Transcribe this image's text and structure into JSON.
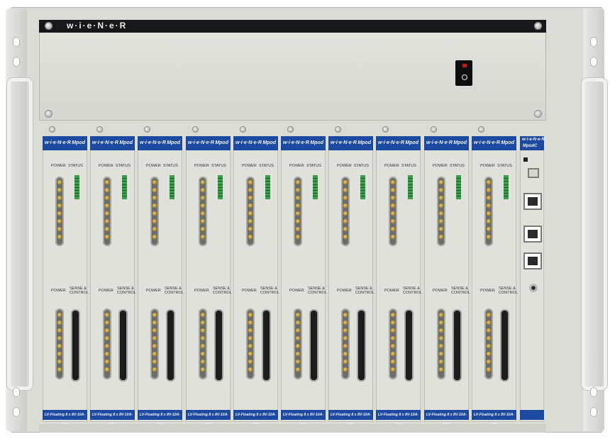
{
  "brand": "w·i·e·N·e·R",
  "modules": [
    {
      "brand": "w·i·e·N·e·R",
      "model": "Mpod",
      "label_power": "POWER",
      "label_status": "STATUS",
      "label_sense": "SENSE & CONTROL",
      "footer": "LV-Floating 8 x 8V-10A-50W"
    },
    {
      "brand": "w·i·e·N·e·R",
      "model": "Mpod",
      "label_power": "POWER",
      "label_status": "STATUS",
      "label_sense": "SENSE & CONTROL",
      "footer": "LV-Floating 8 x 8V-10A-50W"
    },
    {
      "brand": "w·i·e·N·e·R",
      "model": "Mpod",
      "label_power": "POWER",
      "label_status": "STATUS",
      "label_sense": "SENSE & CONTROL",
      "footer": "LV-Floating 8 x 8V-10A-50W"
    },
    {
      "brand": "w·i·e·N·e·R",
      "model": "Mpod",
      "label_power": "POWER",
      "label_status": "STATUS",
      "label_sense": "SENSE & CONTROL",
      "footer": "LV-Floating 8 x 8V-10A-50W"
    },
    {
      "brand": "w·i·e·N·e·R",
      "model": "Mpod",
      "label_power": "POWER",
      "label_status": "STATUS",
      "label_sense": "SENSE & CONTROL",
      "footer": "LV-Floating 8 x 8V-10A-50W"
    },
    {
      "brand": "w·i·e·N·e·R",
      "model": "Mpod",
      "label_power": "POWER",
      "label_status": "STATUS",
      "label_sense": "SENSE & CONTROL",
      "footer": "LV-Floating 8 x 8V-10A-50W"
    },
    {
      "brand": "w·i·e·N·e·R",
      "model": "Mpod",
      "label_power": "POWER",
      "label_status": "STATUS",
      "label_sense": "SENSE & CONTROL",
      "footer": "LV-Floating 8 x 8V-10A-50W"
    },
    {
      "brand": "w·i·e·N·e·R",
      "model": "Mpod",
      "label_power": "POWER",
      "label_status": "STATUS",
      "label_sense": "SENSE & CONTROL",
      "footer": "LV-Floating 8 x 8V-10A-50W"
    },
    {
      "brand": "w·i·e·N·e·R",
      "model": "Mpod",
      "label_power": "POWER",
      "label_status": "STATUS",
      "label_sense": "SENSE & CONTROL",
      "footer": "LV-Floating 8 x 8V-10A-50W"
    },
    {
      "brand": "w·i·e·N·e·R",
      "model": "Mpod",
      "label_power": "POWER",
      "label_status": "STATUS",
      "label_sense": "SENSE & CONTROL",
      "footer": "LV-Floating 8 x 8V-10A-50W"
    }
  ],
  "controller": {
    "brand": "w·i·e·N·e·R",
    "model": "MpodC"
  },
  "colors": {
    "brand_blue": "#1c4aa0",
    "panel": "#e1e1dc",
    "stripe": "#17181c",
    "status_green": "#38a048",
    "switch_led": "#c41818"
  },
  "icons": {
    "power_switch": "rocker-switch-icon",
    "ethernet": "rj45-port-icon",
    "usb": "usb-port-icon"
  }
}
